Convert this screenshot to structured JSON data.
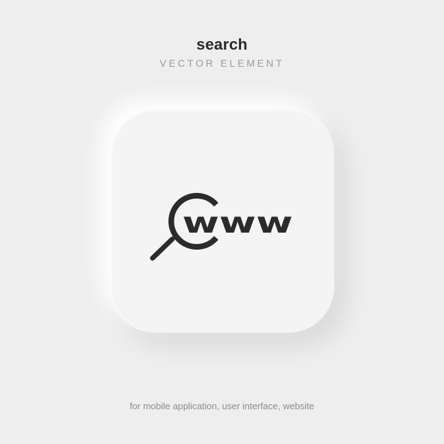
{
  "header": {
    "title": "search",
    "subtitle": "VECTOR ELEMENT"
  },
  "tile": {
    "icon": "search-globe-icon",
    "icon_text": "www",
    "background": "#f4f4f4"
  },
  "footer": {
    "caption": "for mobile application, user interface, website"
  },
  "colors": {
    "page_background": "#eeeeee",
    "icon": "#2b2b2b",
    "title": "#2a2a2a",
    "subtitle": "#9a9a9a",
    "caption": "#8d8d8d"
  }
}
